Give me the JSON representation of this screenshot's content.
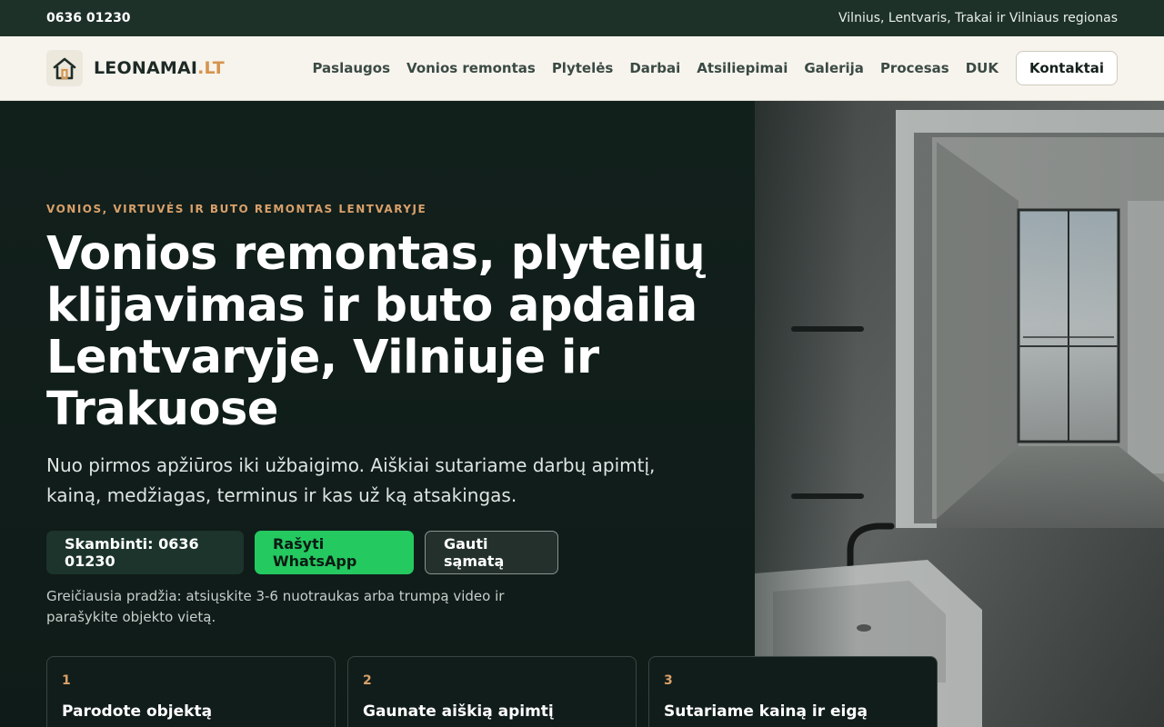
{
  "topbar": {
    "phone": "0636 01230",
    "region": "Vilnius, Lentvaris, Trakai ir Vilniaus regionas"
  },
  "header": {
    "logo_name": "LEONAMAI",
    "logo_tld": ".LT",
    "nav": [
      {
        "label": "Paslaugos"
      },
      {
        "label": "Vonios remontas"
      },
      {
        "label": "Plytelės"
      },
      {
        "label": "Darbai"
      },
      {
        "label": "Atsiliepimai"
      },
      {
        "label": "Galerija"
      },
      {
        "label": "Procesas"
      },
      {
        "label": "DUK"
      }
    ],
    "contact_label": "Kontaktai"
  },
  "hero": {
    "kicker": "VONIOS, VIRTUVĖS IR BUTO REMONTAS LENTVARYJE",
    "headline": "Vonios remontas, plytelių klijavimas ir buto apdaila Lentvaryje, Vilniuje ir Trakuose",
    "lead": "Nuo pirmos apžiūros iki užbaigimo. Aiškiai sutariame darbų apimtį, kainą, medžiagas, terminus ir kas už ką atsakingas.",
    "buttons": {
      "call": "Skambinti: 0636 01230",
      "whatsapp": "Rašyti WhatsApp",
      "quote": "Gauti sąmatą"
    },
    "note": "Greičiausia pradžia: atsiųskite 3-6 nuotraukas arba trumpą video ir parašykite objekto vietą.",
    "steps": [
      {
        "num": "1",
        "title": "Parodote objektą"
      },
      {
        "num": "2",
        "title": "Gaunate aiškią apimtį"
      },
      {
        "num": "3",
        "title": "Sutariame kainą ir eigą"
      }
    ]
  },
  "colors": {
    "topbar": "#1d3129",
    "header_bg": "#f7f4ee",
    "hero_bg": "#101c19",
    "accent": "#d9a06a",
    "whatsapp": "#24c960"
  }
}
